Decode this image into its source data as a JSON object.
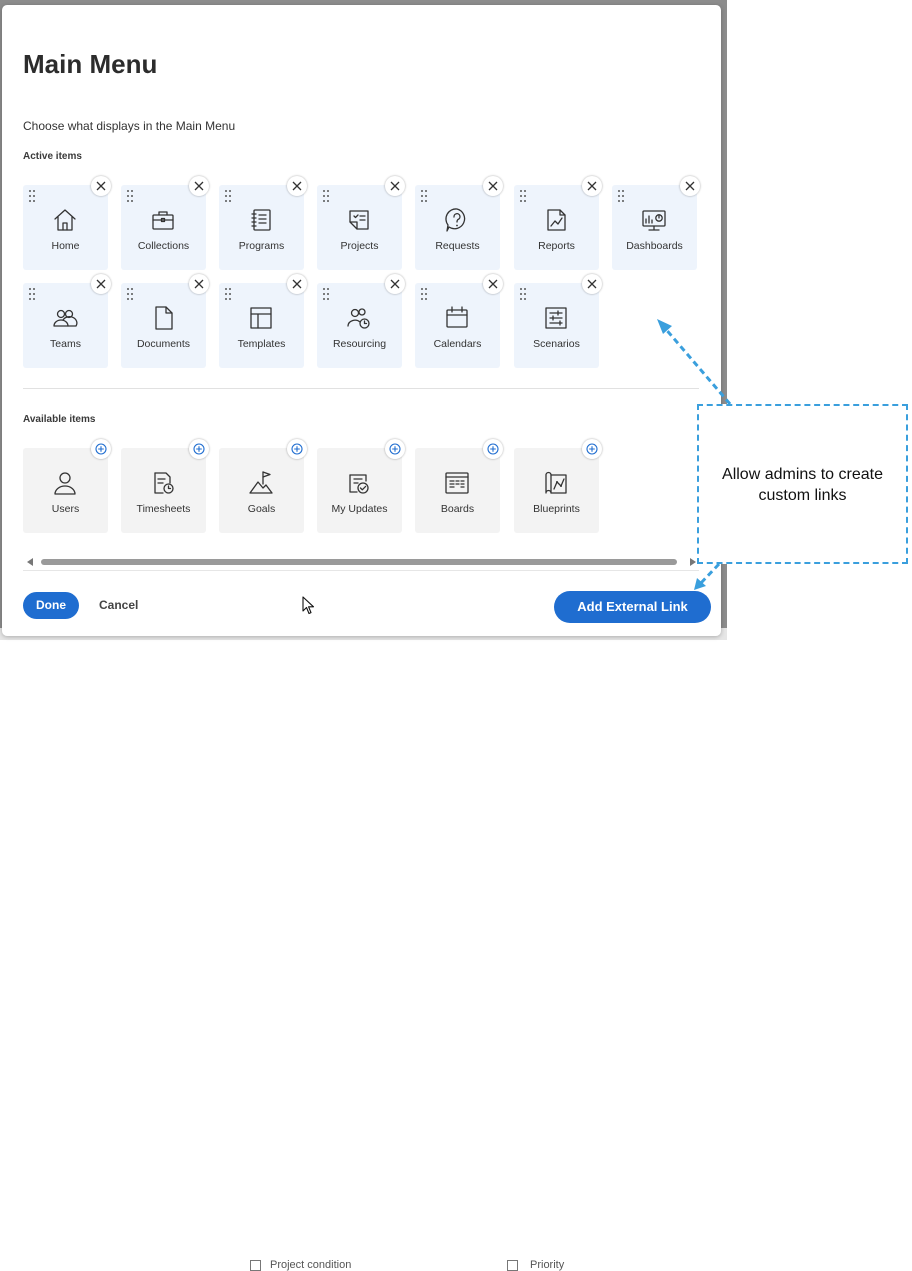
{
  "dialog": {
    "title": "Main Menu",
    "subtitle": "Choose what displays in the Main Menu",
    "active_label": "Active items",
    "available_label": "Available items"
  },
  "active_items": [
    {
      "label": "Home",
      "icon": "home-icon"
    },
    {
      "label": "Collections",
      "icon": "briefcase-icon"
    },
    {
      "label": "Programs",
      "icon": "notebook-icon"
    },
    {
      "label": "Projects",
      "icon": "project-checklist-icon"
    },
    {
      "label": "Requests",
      "icon": "question-bubble-icon"
    },
    {
      "label": "Reports",
      "icon": "report-chart-icon"
    },
    {
      "label": "Dashboards",
      "icon": "dashboard-monitor-icon"
    },
    {
      "label": "Teams",
      "icon": "team-people-icon"
    },
    {
      "label": "Documents",
      "icon": "document-icon"
    },
    {
      "label": "Templates",
      "icon": "template-layout-icon"
    },
    {
      "label": "Resourcing",
      "icon": "resourcing-people-clock-icon"
    },
    {
      "label": "Calendars",
      "icon": "calendar-icon"
    },
    {
      "label": "Scenarios",
      "icon": "scenario-sliders-icon"
    }
  ],
  "available_items": [
    {
      "label": "Users",
      "icon": "user-icon"
    },
    {
      "label": "Timesheets",
      "icon": "timesheet-clock-icon"
    },
    {
      "label": "Goals",
      "icon": "goal-flag-mountain-icon"
    },
    {
      "label": "My Updates",
      "icon": "updates-check-icon"
    },
    {
      "label": "Boards",
      "icon": "board-icon"
    },
    {
      "label": "Blueprints",
      "icon": "blueprint-map-icon"
    }
  ],
  "footer": {
    "done_label": "Done",
    "cancel_label": "Cancel",
    "add_external_link_label": "Add External Link"
  },
  "background": {
    "row_left": "Project condition",
    "row_right": "Priority"
  },
  "callout": {
    "line1": "Allow admins to create",
    "line2": "custom links"
  },
  "colors": {
    "primary": "#1f6dd0",
    "active_tile": "#eef4fc",
    "available_tile": "#f3f3f3",
    "callout_border": "#3a9fdd"
  }
}
